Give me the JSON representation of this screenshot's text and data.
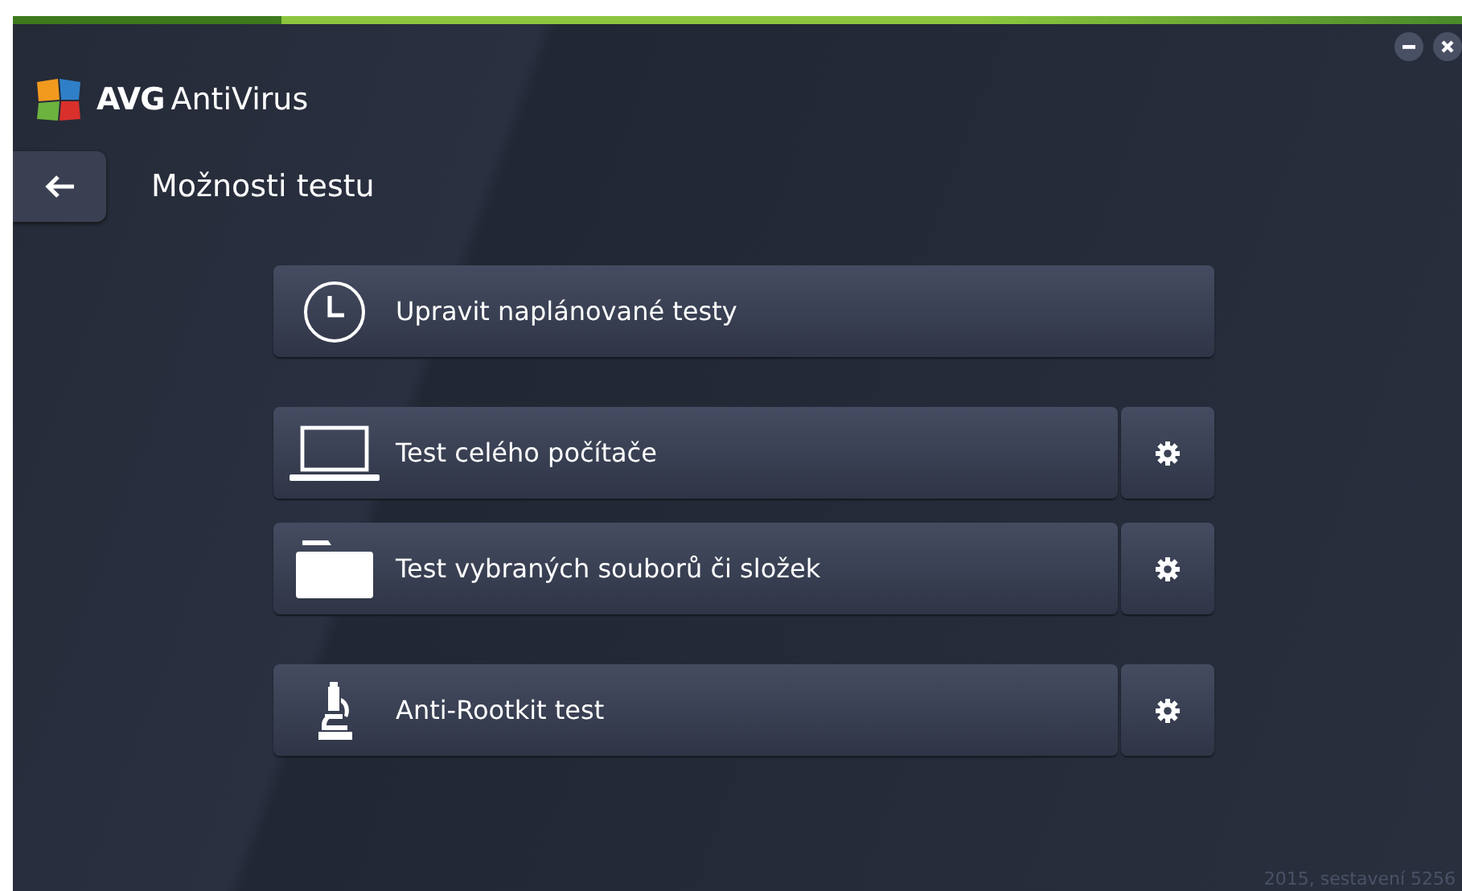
{
  "window": {
    "brand": "AVG",
    "product": "AntiVirus",
    "footer": "2015, sestavení 5256"
  },
  "header": {
    "title": "Možnosti testu"
  },
  "groups": [
    [
      {
        "label": "Upravit naplánované testy",
        "kind": "clock",
        "settings": false
      }
    ],
    [
      {
        "label": "Test celého počítače",
        "kind": "laptop",
        "settings": true
      },
      {
        "label": "Test vybraných souborů či složek",
        "kind": "folder",
        "settings": true
      }
    ],
    [
      {
        "label": "Anti-Rootkit test",
        "kind": "microscope",
        "settings": true
      }
    ]
  ]
}
